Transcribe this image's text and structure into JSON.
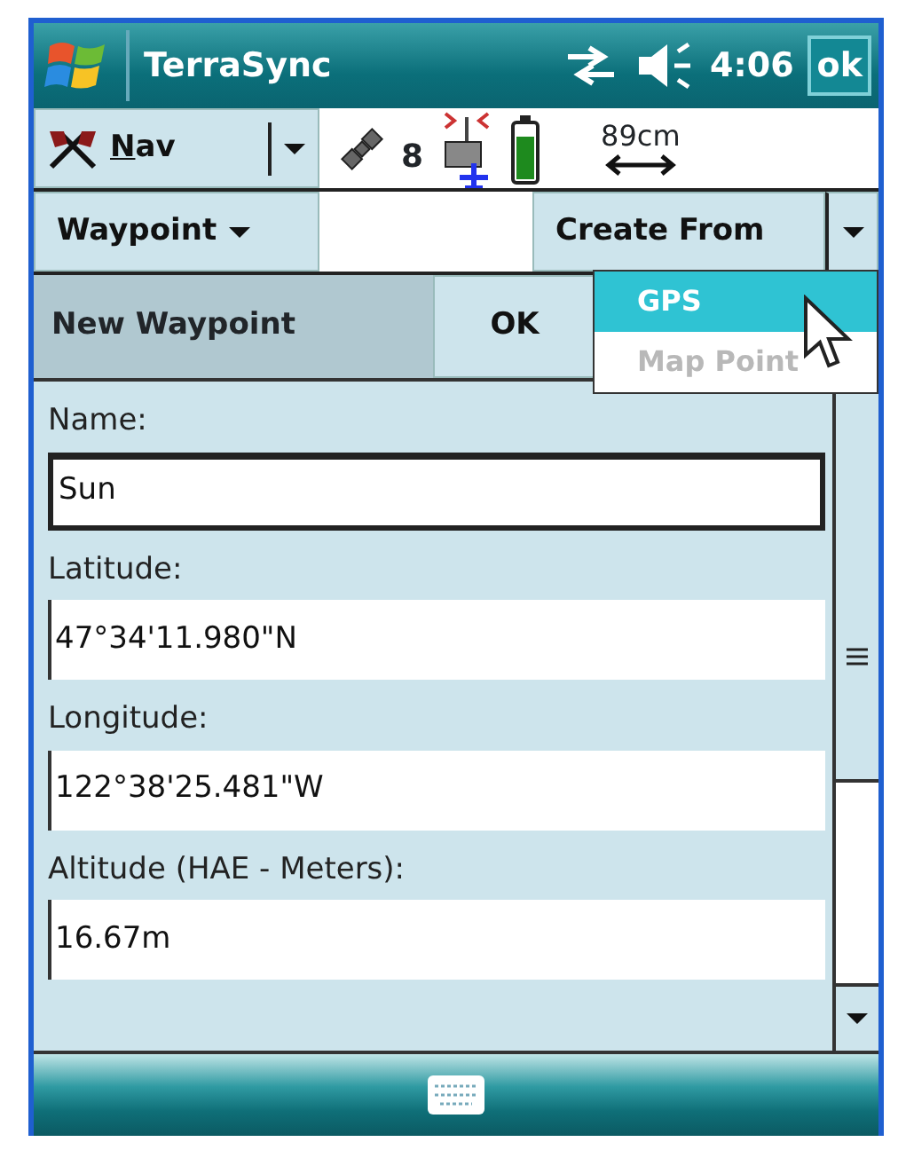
{
  "title_bar": {
    "title": "TerraSync",
    "time": "4:06",
    "ok_button": "ok"
  },
  "toolbar": {
    "nav_button": "Nav",
    "satellite_count": "8",
    "accuracy": "89cm"
  },
  "layer_select": {
    "value": "Waypoint"
  },
  "create_from": {
    "label": "Create From",
    "menu": [
      {
        "label": "GPS",
        "selected": true,
        "disabled": false
      },
      {
        "label": "Map Point",
        "selected": false,
        "disabled": true
      }
    ]
  },
  "form": {
    "title": "New Waypoint",
    "ok_button": "OK",
    "fields": [
      {
        "label": "Name:",
        "value": "Sun",
        "kind": "boxed"
      },
      {
        "label": "Latitude:",
        "value": "47°34'11.980\"N",
        "kind": "plain"
      },
      {
        "label": "Longitude:",
        "value": "122°38'25.481\"W",
        "kind": "plain"
      },
      {
        "label": "Altitude (HAE - Meters):",
        "value": "16.67m",
        "kind": "plain"
      }
    ]
  }
}
